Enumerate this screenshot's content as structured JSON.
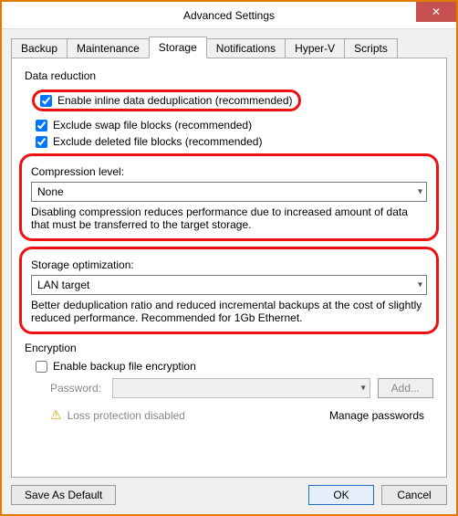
{
  "window": {
    "title": "Advanced Settings",
    "close_tooltip": "Close"
  },
  "tabs": [
    {
      "label": "Backup"
    },
    {
      "label": "Maintenance"
    },
    {
      "label": "Storage"
    },
    {
      "label": "Notifications"
    },
    {
      "label": "Hyper-V"
    },
    {
      "label": "Scripts"
    }
  ],
  "storage": {
    "data_reduction": {
      "heading": "Data reduction",
      "dedup_label": "Enable inline data deduplication (recommended)",
      "swap_label": "Exclude swap file blocks (recommended)",
      "deleted_label": "Exclude deleted file blocks (recommended)",
      "compression_label": "Compression level:",
      "compression_value": "None",
      "compression_help": "Disabling compression reduces performance due to increased amount of data that must be transferred to the target storage.",
      "storage_opt_label": "Storage optimization:",
      "storage_opt_value": "LAN target",
      "storage_opt_help": "Better deduplication ratio and reduced incremental backups at the cost of slightly reduced performance. Recommended for 1Gb Ethernet."
    },
    "encryption": {
      "heading": "Encryption",
      "enable_label": "Enable backup file encryption",
      "password_label": "Password:",
      "add_button": "Add...",
      "loss_text": "Loss protection disabled",
      "manage_text": "Manage passwords"
    }
  },
  "buttons": {
    "save_default": "Save As Default",
    "ok": "OK",
    "cancel": "Cancel"
  }
}
